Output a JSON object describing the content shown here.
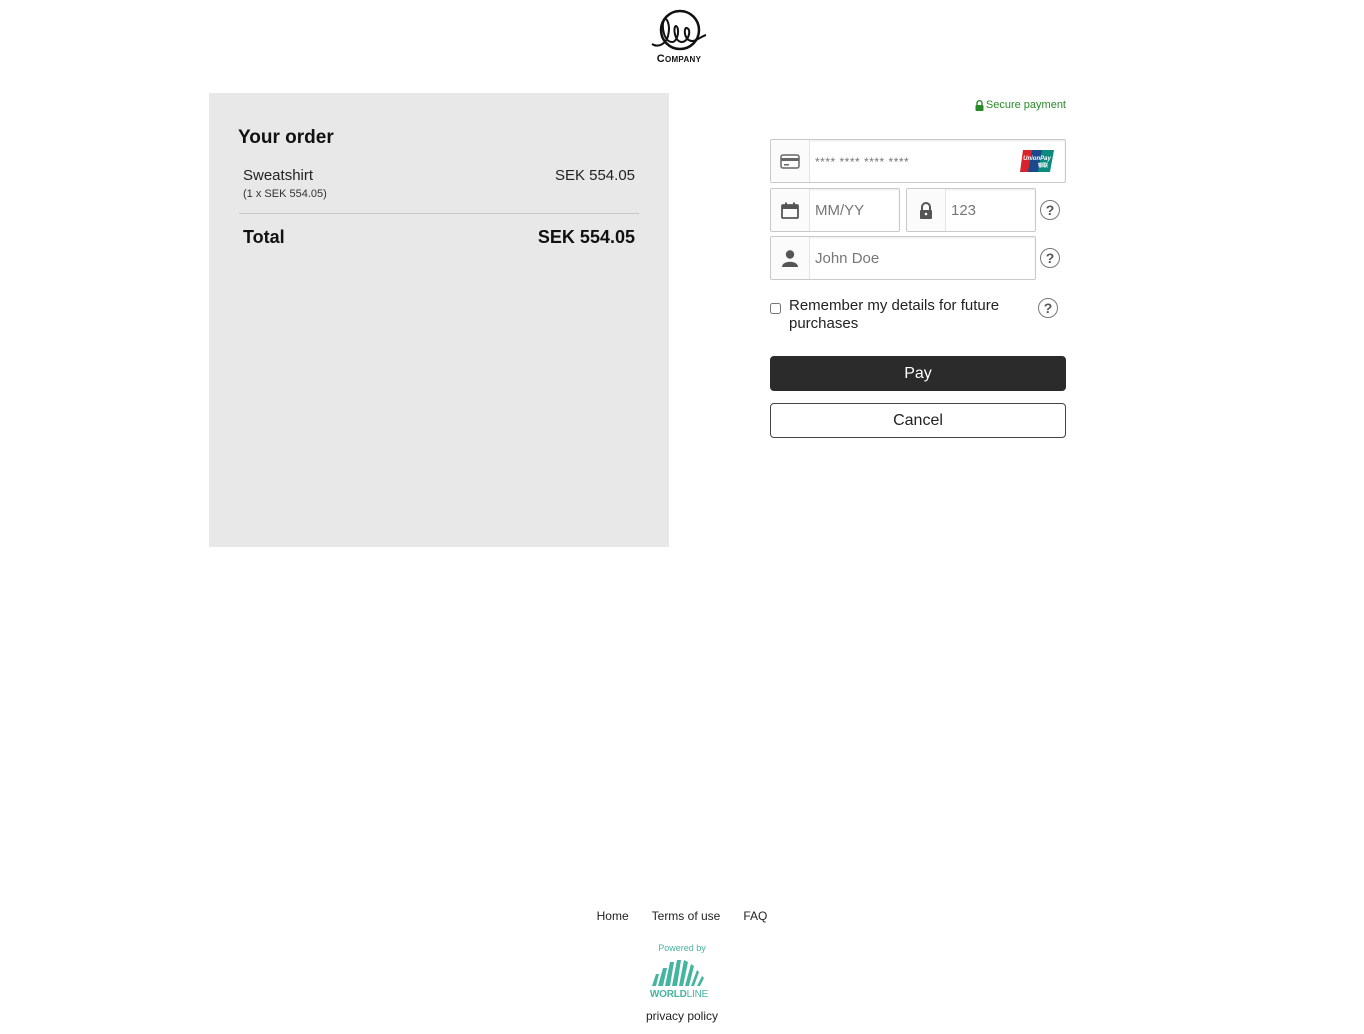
{
  "header": {
    "logo_text": "Company"
  },
  "order": {
    "title": "Your order",
    "items": [
      {
        "name": "Sweatshirt",
        "detail": "(1 x SEK 554.05)",
        "price": "SEK 554.05"
      }
    ],
    "total_label": "Total",
    "total_value": "SEK 554.05",
    "panel_color": "#e8e8e8"
  },
  "payment": {
    "secure_label": "Secure payment",
    "secure_color": "#2a8a2a",
    "card_number": {
      "placeholder": "**** **** **** ****",
      "value": "",
      "card_brand": "UnionPay"
    },
    "expiry": {
      "placeholder": "MM/YY",
      "value": ""
    },
    "cvc": {
      "placeholder": "123",
      "value": ""
    },
    "cardholder": {
      "placeholder": "John Doe",
      "value": ""
    },
    "remember_label": "Remember my details for future purchases",
    "remember_checked": false,
    "help_glyph": "?",
    "pay_label": "Pay",
    "cancel_label": "Cancel",
    "pay_color": "#2b2b2b"
  },
  "footer": {
    "links": [
      "Home",
      "Terms of use",
      "FAQ"
    ],
    "powered_by": "Powered by",
    "brand_bold": "WORLD",
    "brand_light": "LINE",
    "brand_color": "#46b5a0",
    "privacy_label": "privacy policy"
  }
}
